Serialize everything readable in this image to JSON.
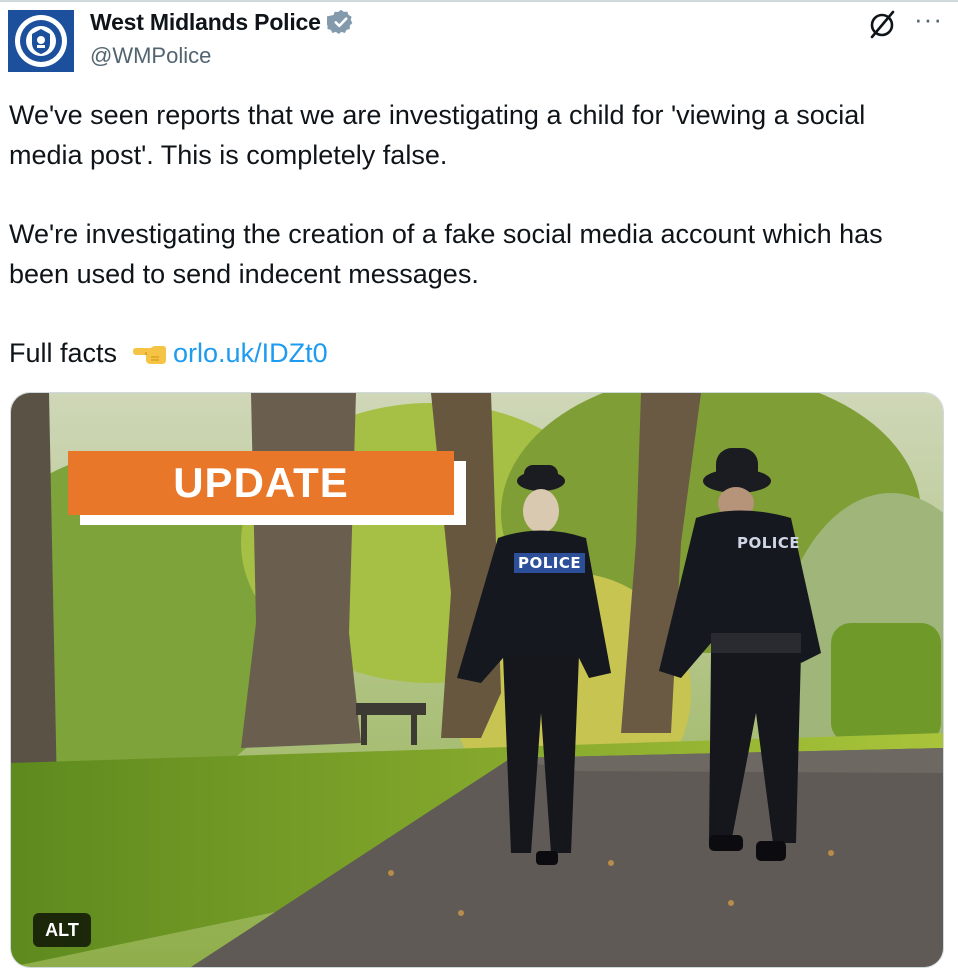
{
  "author": {
    "name": "West Midlands Police",
    "handle": "@WMPolice",
    "verified": true,
    "avatar_icon": "police-crest-icon",
    "brand_color": "#1c4f9c"
  },
  "actions": {
    "grok_icon": "grok-icon",
    "more_label": "···"
  },
  "tweet": {
    "paragraph1": "We've seen reports that we are investigating a child for 'viewing a social media post'. This is completely false.",
    "paragraph2": "We're investigating the creation of a fake social media account which has been used to send indecent messages.",
    "facts_label": "Full facts",
    "facts_icon": "pointing-hand-icon",
    "link_text": "orlo.uk/IDZt0",
    "link_color": "#1d9bf0"
  },
  "media": {
    "banner_text": "UPDATE",
    "banner_color": "#e8772a",
    "alt_label": "ALT",
    "officer_left_label": "POLICE",
    "officer_right_label": "POLICE"
  }
}
